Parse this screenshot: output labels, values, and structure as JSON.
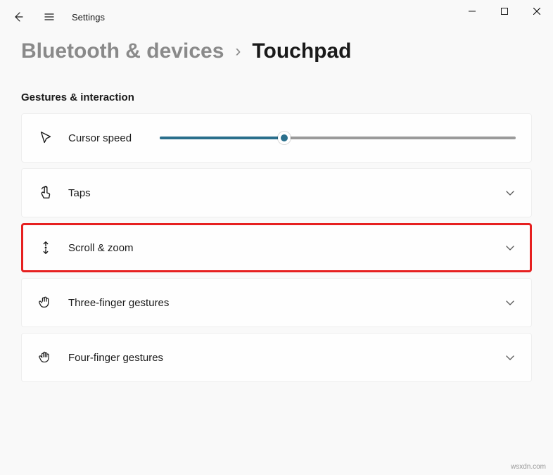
{
  "app": {
    "title": "Settings"
  },
  "breadcrumb": {
    "parent": "Bluetooth & devices",
    "current": "Touchpad"
  },
  "section": {
    "header": "Gestures & interaction"
  },
  "cards": {
    "cursor_speed": {
      "label": "Cursor speed",
      "slider_percent": 35
    },
    "taps": {
      "label": "Taps"
    },
    "scroll_zoom": {
      "label": "Scroll & zoom"
    },
    "three_finger": {
      "label": "Three-finger gestures"
    },
    "four_finger": {
      "label": "Four-finger gestures"
    }
  },
  "watermark": "wsxdn.com"
}
